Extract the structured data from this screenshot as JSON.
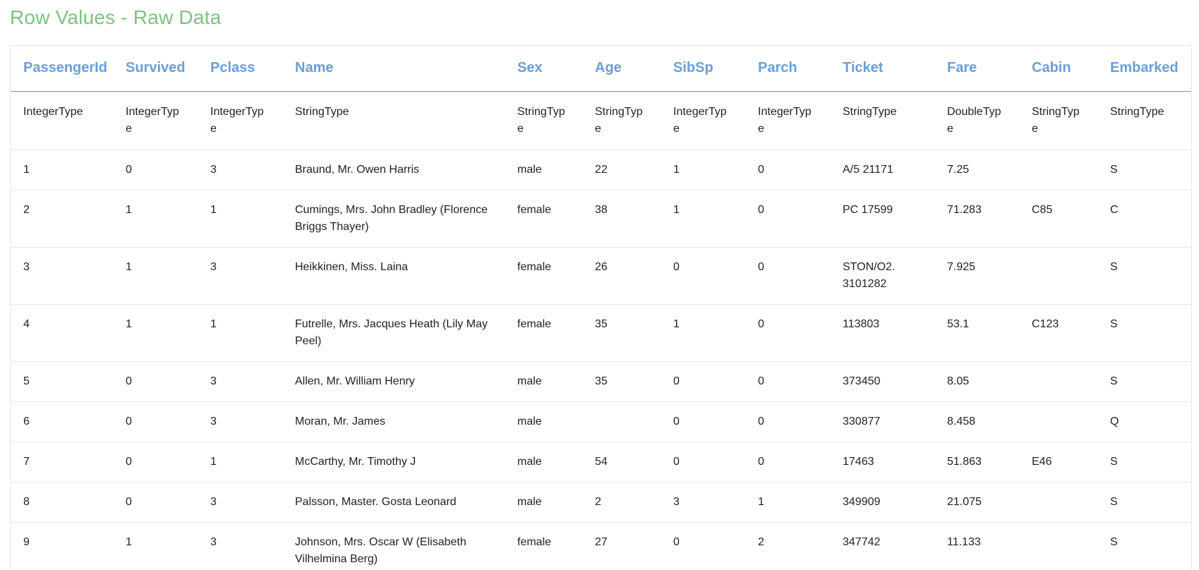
{
  "page": {
    "title": "Row Values - Raw Data"
  },
  "table": {
    "columns": [
      "PassengerId",
      "Survived",
      "Pclass",
      "Name",
      "Sex",
      "Age",
      "SibSp",
      "Parch",
      "Ticket",
      "Fare",
      "Cabin",
      "Embarked"
    ],
    "types": [
      "IntegerType",
      "IntegerType",
      "IntegerType",
      "StringType",
      "StringType",
      "StringType",
      "IntegerType",
      "IntegerType",
      "StringType",
      "DoubleType",
      "StringType",
      "StringType"
    ],
    "rows": [
      [
        "1",
        "0",
        "3",
        "Braund, Mr. Owen Harris",
        "male",
        "22",
        "1",
        "0",
        "A/5 21171",
        "7.25",
        "",
        "S"
      ],
      [
        "2",
        "1",
        "1",
        "Cumings, Mrs. John Bradley (Florence Briggs Thayer)",
        "female",
        "38",
        "1",
        "0",
        "PC 17599",
        "71.283",
        "C85",
        "C"
      ],
      [
        "3",
        "1",
        "3",
        "Heikkinen, Miss. Laina",
        "female",
        "26",
        "0",
        "0",
        "STON/O2. 3101282",
        "7.925",
        "",
        "S"
      ],
      [
        "4",
        "1",
        "1",
        "Futrelle, Mrs. Jacques Heath (Lily May Peel)",
        "female",
        "35",
        "1",
        "0",
        "113803",
        "53.1",
        "C123",
        "S"
      ],
      [
        "5",
        "0",
        "3",
        "Allen, Mr. William Henry",
        "male",
        "35",
        "0",
        "0",
        "373450",
        "8.05",
        "",
        "S"
      ],
      [
        "6",
        "0",
        "3",
        "Moran, Mr. James",
        "male",
        "",
        "0",
        "0",
        "330877",
        "8.458",
        "",
        "Q"
      ],
      [
        "7",
        "0",
        "1",
        "McCarthy, Mr. Timothy J",
        "male",
        "54",
        "0",
        "0",
        "17463",
        "51.863",
        "E46",
        "S"
      ],
      [
        "8",
        "0",
        "3",
        "Palsson, Master. Gosta Leonard",
        "male",
        "2",
        "3",
        "1",
        "349909",
        "21.075",
        "",
        "S"
      ],
      [
        "9",
        "1",
        "3",
        "Johnson, Mrs. Oscar W (Elisabeth Vilhelmina Berg)",
        "female",
        "27",
        "0",
        "2",
        "347742",
        "11.133",
        "",
        "S"
      ]
    ]
  },
  "colors": {
    "title": "#7cc37f",
    "header": "#6a9fd6",
    "border": "#e6e6e6"
  }
}
